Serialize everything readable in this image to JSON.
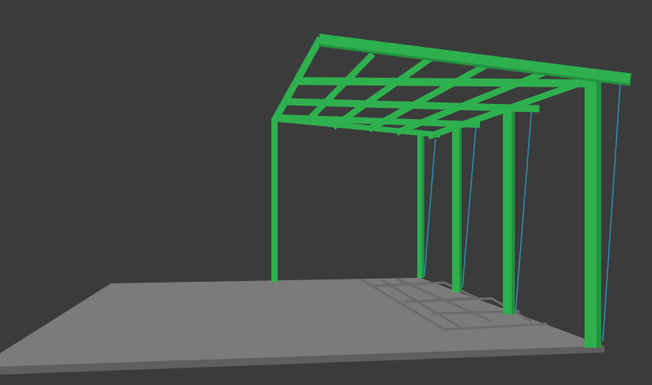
{
  "scene": {
    "colors": {
      "background": "#3b3b3b",
      "floor_top": "#7b7b7b",
      "floor_edge": "#5e5e5e",
      "floor_marks": "#6c6c6c",
      "frame": "#2eb04f",
      "frame_shade": "#23903f",
      "frame_light": "#3cc25d",
      "cable": "#2a8fb5"
    },
    "objects": [
      "floor-slab",
      "steel-frame",
      "columns",
      "roof-beams",
      "bracing-cables"
    ]
  }
}
